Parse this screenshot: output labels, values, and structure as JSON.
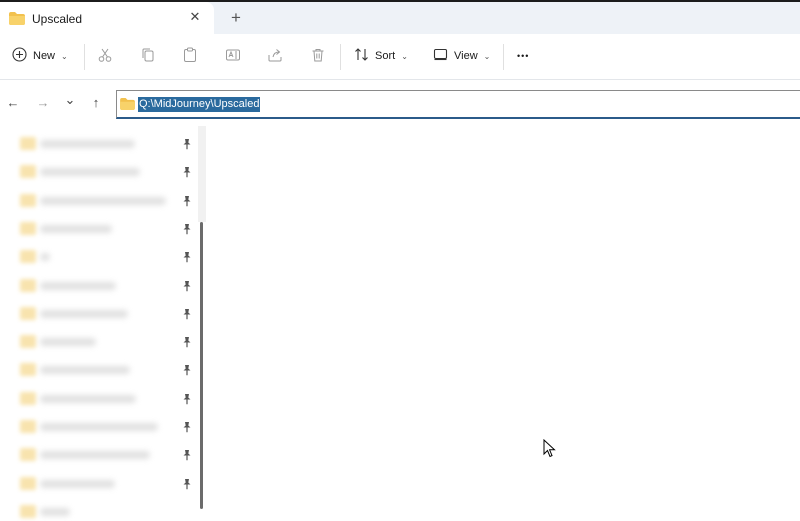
{
  "window": {
    "tab_title": "Upscaled",
    "close_tab_glyph": "✕",
    "new_tab_glyph": "+"
  },
  "command_bar": {
    "new_label": "New",
    "sort_label": "Sort",
    "view_label": "View",
    "more_glyph": "•••",
    "icons": [
      "add-circle-icon",
      "cut-icon",
      "copy-icon",
      "paste-icon",
      "rename-icon",
      "share-icon",
      "delete-icon",
      "sort-icon",
      "view-icon",
      "more-icon"
    ]
  },
  "navigation": {
    "back_glyph": "←",
    "forward_glyph": "→",
    "recent_glyph": "⌄",
    "up_glyph": "↑",
    "address_path": "Q:\\MidJourney\\Upscaled"
  },
  "sidebar": {
    "items_blurred": true
  },
  "colors": {
    "accent": "#2a6a9e",
    "folder": "#f2c14e",
    "tab_strip": "#eef2f7"
  }
}
